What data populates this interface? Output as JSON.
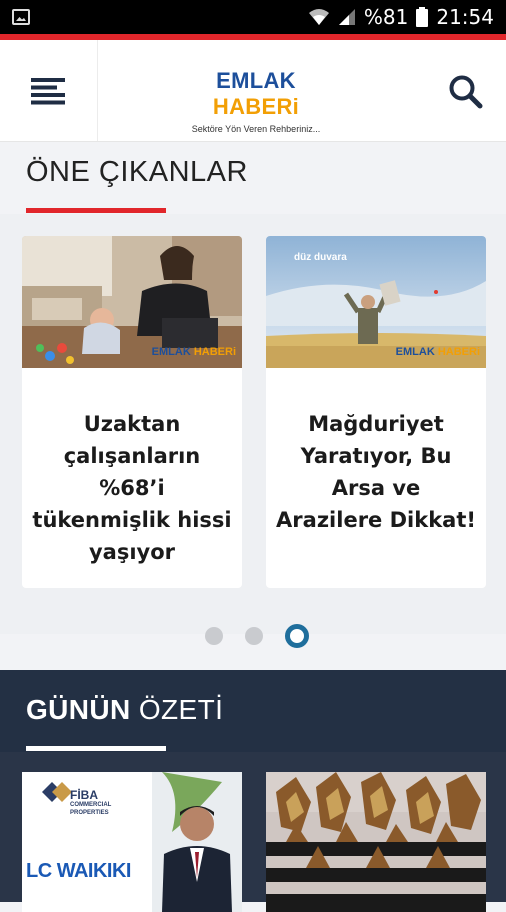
{
  "status_bar": {
    "battery": "%81",
    "time": "21:54"
  },
  "header": {
    "logo_part1": "EMLAK",
    "logo_part2": "HABERi",
    "tagline": "Sektöre Yön Veren Rehberiniz..."
  },
  "featured": {
    "title": "ÖNE ÇIKANLAR",
    "cards": [
      {
        "title": "Uzaktan çalışanların %68’i tükenmişlik hissi yaşıyor",
        "watermark1": "EMLAK",
        "watermark2": "HABERi"
      },
      {
        "title": "Mağduriyet Yaratıyor, Bu Arsa ve Arazilere Dikkat!",
        "watermark1": "EMLAK",
        "watermark2": "HABERi",
        "image_text": "düz duvara"
      }
    ],
    "pagination": {
      "count": 3,
      "active": 3
    }
  },
  "summary": {
    "title_bold": "GÜNÜN",
    "title_rest": "ÖZETİ",
    "cards": [
      {
        "brand_line1": "FİBA",
        "brand_line2": "COMMERCIAL",
        "brand_line3": "PROPERTIES",
        "brand2": "LC WAIKIKI"
      },
      {}
    ]
  },
  "colors": {
    "accent_red": "#e1262b",
    "brand_blue": "#1d4f9b",
    "brand_orange": "#f29f05",
    "dark_navy": "#233044",
    "active_dot": "#1f6e9c"
  },
  "icons": [
    "gallery-icon",
    "wifi-icon",
    "signal-icon",
    "battery-icon",
    "hamburger-menu-icon",
    "search-icon"
  ]
}
